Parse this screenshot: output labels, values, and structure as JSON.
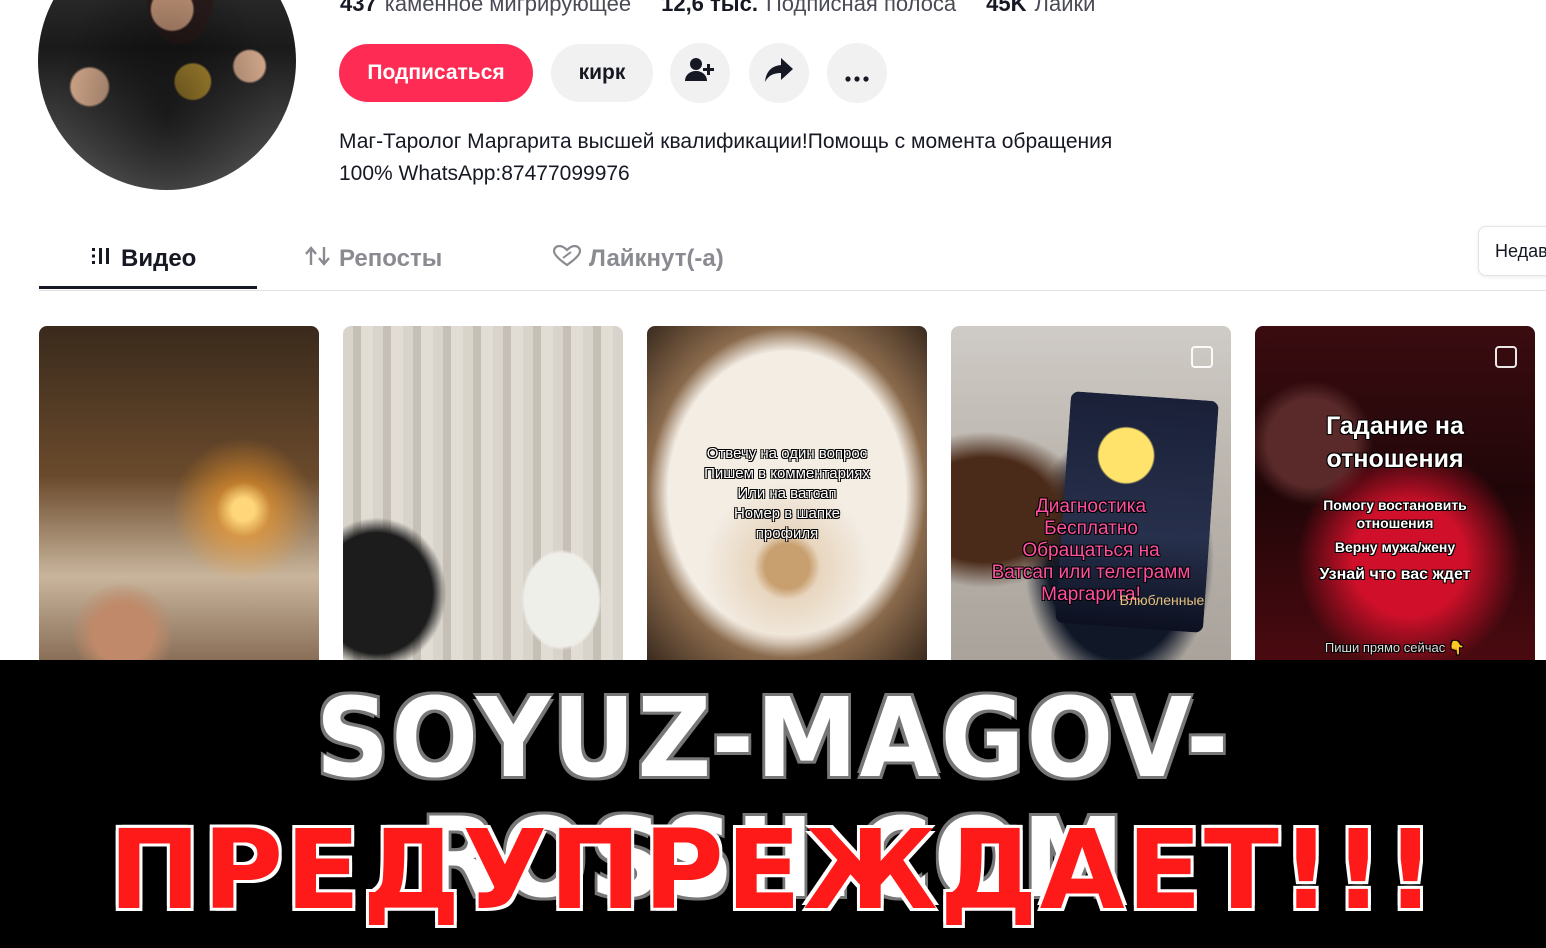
{
  "profile": {
    "stats": [
      {
        "value": "437",
        "label": "каменное мигрирующее"
      },
      {
        "value": "12,6 тыс.",
        "label": "Подписная полоса"
      },
      {
        "value": "45K",
        "label": "Лайки"
      }
    ],
    "follow_label": "Подписаться",
    "message_label": "кирк",
    "bio_line1": "Маг-Таролог Маргарита высшей квалификации!Помощь с момента обращения",
    "bio_line2": "100% WhatsApp:87477099976"
  },
  "tabs": {
    "videos": "Видео",
    "reposts": "Репосты",
    "liked": "Лайкнут(-а)",
    "sort_label": "Недав"
  },
  "videos": [
    {
      "caption": ""
    },
    {
      "caption": ""
    },
    {
      "caption_lines": [
        "Отвечу на один вопрос",
        "Пишем в комментариях",
        "Или на ватсап",
        "Номер в шапке",
        "профиля"
      ]
    },
    {
      "caption_lines": [
        "Диагностика",
        "Бесплатно",
        "Обращаться на",
        "Ватсап или телеграмм",
        "Маргарита!"
      ],
      "card_text": "Влюбленные"
    },
    {
      "title_lines": [
        "Гадание на",
        "отношения"
      ],
      "lines": [
        "Помогу востановить",
        "отношения",
        "Верну мужа/жену",
        "Узнай что вас ждет",
        "Пиши прямо сейчас 👇"
      ]
    }
  ],
  "banner": {
    "line1": "SOYUZ-MAGOV-ROSSII.COM",
    "line2": "ПРЕДУПРЕЖДАЕТ!!!"
  },
  "colors": {
    "accent": "#fe2c55",
    "banner_bg": "#000000",
    "banner_red": "#ff1a1a"
  },
  "icons": [
    "add-user-icon",
    "share-icon",
    "more-icon",
    "grid-icon",
    "repost-icon",
    "liked-heart-icon"
  ]
}
